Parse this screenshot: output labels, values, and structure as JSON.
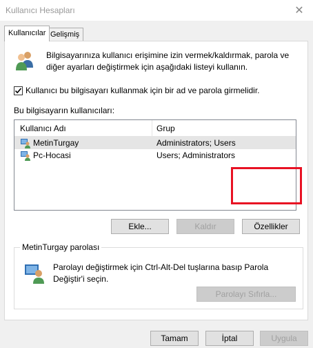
{
  "window": {
    "title": "Kullanıcı Hesapları",
    "close": "✕"
  },
  "tabs": [
    {
      "label": "Kullanıcılar"
    },
    {
      "label": "Gelişmiş"
    }
  ],
  "intro": {
    "text": "Bilgisayarınıza kullanıcı erişimine izin vermek/kaldırmak, parola ve diğer ayarları değiştirmek için aşağıdaki listeyi kullanın."
  },
  "require_password": {
    "label": "Kullanıcı bu bilgisayarı kullanmak için bir ad ve parola girmelidir.",
    "checked": true
  },
  "users": {
    "label": "Bu bilgisayarın kullanıcıları:",
    "columns": [
      "Kullanıcı Adı",
      "Grup"
    ],
    "rows": [
      {
        "name": "MetinTurgay",
        "group": "Administrators; Users",
        "selected": true
      },
      {
        "name": "Pc-Hocasi",
        "group": "Users; Administrators",
        "selected": false
      }
    ]
  },
  "buttons": {
    "add": "Ekle...",
    "remove": "Kaldır",
    "properties": "Özellikler"
  },
  "password_group": {
    "title": "MetinTurgay parolası",
    "text": "Parolayı değiştirmek için Ctrl-Alt-Del tuşlarına basıp Parola Değiştir'i seçin.",
    "reset": "Parolayı Sıfırla..."
  },
  "footer": {
    "ok": "Tamam",
    "cancel": "İptal",
    "apply": "Uygula"
  },
  "colors": {
    "highlight": "#e81123",
    "selected_row": "#e5e5e5"
  }
}
